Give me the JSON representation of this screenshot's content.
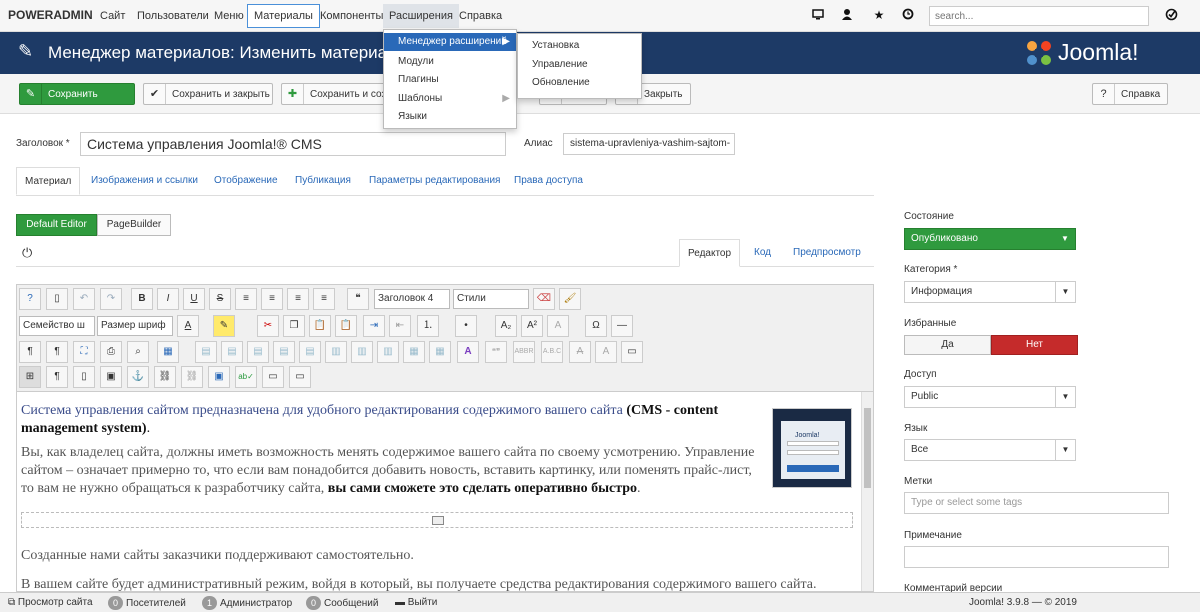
{
  "topnav": {
    "brand": "POWERADMIN",
    "items": [
      "Сайт",
      "Пользователи",
      "Меню",
      "Материалы",
      "Компоненты",
      "Расширения",
      "Справка"
    ],
    "search_placeholder": "search..."
  },
  "header": {
    "title": "Менеджер материалов: Изменить материал",
    "logo_text": "Joomla!"
  },
  "toolbar": {
    "save": "Сохранить",
    "save_close": "Сохранить и закрыть",
    "save_new": "Сохранить и соз",
    "close": "Закрыть",
    "help": "Справка"
  },
  "menu": {
    "items": [
      "Менеджер расширений",
      "Модули",
      "Плагины",
      "Шаблоны",
      "Языки"
    ],
    "sub": [
      "Установка",
      "Управление",
      "Обновление"
    ]
  },
  "form": {
    "title_label": "Заголовок *",
    "title_value": "Система управления Joomla!® CMS",
    "alias_label": "Алиас",
    "alias_value": "sistema-upravleniya-vashim-sajtom-"
  },
  "tabs": [
    "Материал",
    "Изображения и ссылки",
    "Отображение",
    "Публикация",
    "Параметры редактирования",
    "Права доступа"
  ],
  "editor_switch": [
    "Default Editor",
    "PageBuilder"
  ],
  "editor_tabs": [
    "Редактор",
    "Код",
    "Предпросмотр"
  ],
  "editor_dd": {
    "heading": "Заголовок 4",
    "styles": "Стили",
    "font_family": "Семейство ш",
    "font_size": "Размер шриф"
  },
  "content": {
    "p1a": "Система управления сайтом предназначена для удобного редактирования содержимого вашего сайта ",
    "p1b": "(CMS - content management system)",
    "p2a": "Вы, как владелец сайта, должны иметь возможность менять содержимое вашего сайта по своему усмотрению. Управление сайтом – означает примерно то, что если вам понадобится добавить новость, вставить картинку, или поменять прайс-лист, то вам не нужно обращаться к разработчику сайта, ",
    "p2b": "вы сами сможете это сделать оперативно быстро",
    "p3": "Созданные нами сайты заказчики поддерживают самостоятельно.",
    "p4": "В вашем сайте будет административный режим, войдя в который, вы получаете средства редактирования содержимого вашего сайта."
  },
  "sidebar": {
    "state_label": "Состояние",
    "state_value": "Опубликовано",
    "category_label": "Категория *",
    "category_value": "Информация",
    "featured_label": "Избранные",
    "yes": "Да",
    "no": "Нет",
    "access_label": "Доступ",
    "access_value": "Public",
    "lang_label": "Язык",
    "lang_value": "Все",
    "tags_label": "Метки",
    "tags_placeholder": "Type or select some tags",
    "note_label": "Примечание",
    "version_label": "Комментарий версии"
  },
  "status": {
    "preview": "Просмотр сайта",
    "visitors_n": "0",
    "visitors": "Посетителей",
    "admins_n": "1",
    "admins": "Администратор",
    "msgs_n": "0",
    "msgs": "Сообщений",
    "logout": "Выйти",
    "version": "Joomla! 3.9.8 — © 2019"
  }
}
